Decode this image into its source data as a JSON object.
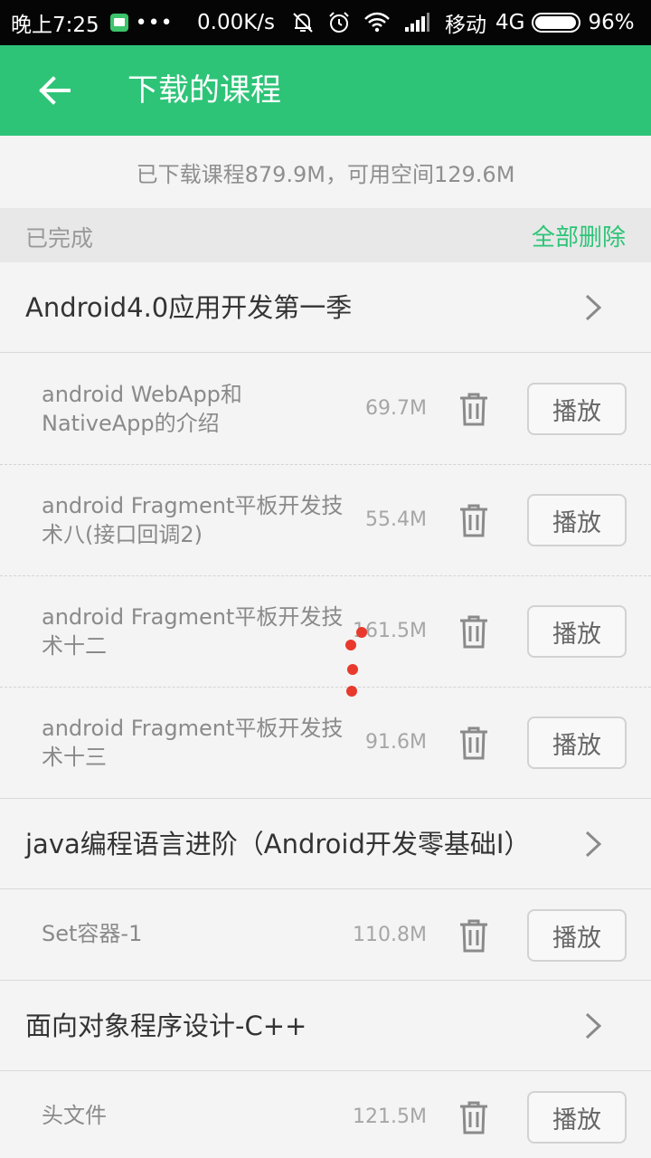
{
  "status_bar": {
    "time": "晚上7:25",
    "dots": "•••",
    "network_speed": "0.00K/s",
    "carrier": "移动",
    "network_type": "4G",
    "battery_percent": "96%",
    "battery_level": 0.96,
    "icons": [
      "app-notification-icon",
      "mute-bell-icon",
      "alarm-icon",
      "wifi-icon",
      "signal-icon",
      "battery-icon"
    ]
  },
  "app_bar": {
    "title": "下载的课程",
    "back_icon": "arrow-left-icon",
    "background": "#2ec478"
  },
  "storage_info": "已下载课程879.9M，可用空间129.6M",
  "section": {
    "label": "已完成",
    "delete_all": "全部删除",
    "accent": "#2ec478"
  },
  "courses": [
    {
      "title": "Android4.0应用开发第一季",
      "items": [
        {
          "title": "android WebApp和NativeApp的介绍",
          "size": "69.7M",
          "action": "播放"
        },
        {
          "title": "android Fragment平板开发技术八(接口回调2)",
          "size": "55.4M",
          "action": "播放"
        },
        {
          "title": "android Fragment平板开发技术十二",
          "size": "161.5M",
          "action": "播放"
        },
        {
          "title": "android Fragment平板开发技术十三",
          "size": "91.6M",
          "action": "播放"
        }
      ]
    },
    {
      "title": "java编程语言进阶（Android开发零基础I）",
      "items": [
        {
          "title": "Set容器-1",
          "size": "110.8M",
          "action": "播放"
        }
      ]
    },
    {
      "title": "面向对象程序设计-C++",
      "items": [
        {
          "title": "头文件",
          "size": "121.5M",
          "action": "播放"
        }
      ]
    }
  ],
  "overlay": {
    "loading_dots_color": "#e8392d"
  }
}
